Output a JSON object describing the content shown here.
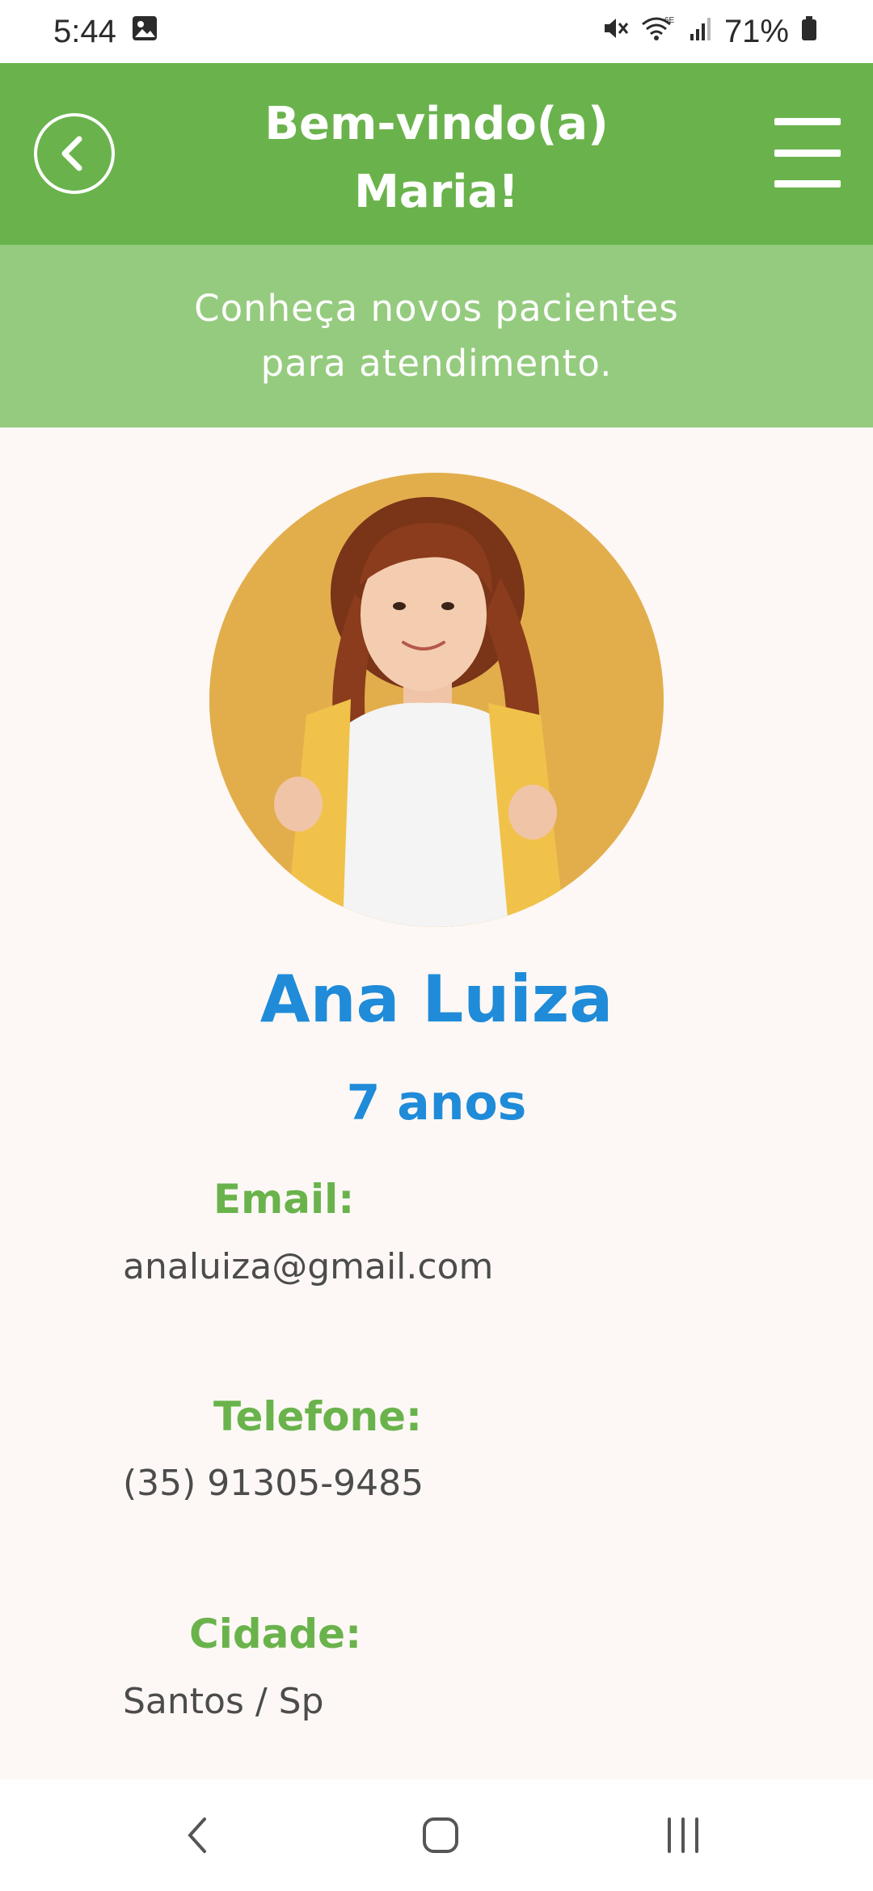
{
  "status_bar": {
    "time": "5:44",
    "battery": "71%",
    "icons": [
      "gallery-icon",
      "mute-icon",
      "wifi-6e-icon",
      "signal-icon",
      "battery-icon"
    ]
  },
  "header": {
    "title_line1": "Bem-vindo(a)",
    "title_line2": "Maria!",
    "back_icon": "chevron-left-icon",
    "menu_icon": "hamburger-menu-icon"
  },
  "subheader": {
    "line1": "Conheça novos pacientes",
    "line2": "para atendimento."
  },
  "patient": {
    "name": "Ana Luiza",
    "age": "7 anos",
    "photo": "patient-photo"
  },
  "fields": {
    "email_label": "Email:",
    "email_value": "analuiza@gmail.com",
    "phone_label": "Telefone:",
    "phone_value": "(35) 91305-9485",
    "city_label": "Cidade:",
    "city_value": "Santos / Sp"
  },
  "nav_bar": {
    "back": "nav-back-icon",
    "home": "nav-home-icon",
    "recents": "nav-recents-icon"
  },
  "colors": {
    "header_green": "#6ab34c",
    "subheader_green": "#95cb7e",
    "name_blue": "#1f8bd9",
    "label_green": "#6ab34c",
    "page_background": "#fdf8f5"
  }
}
